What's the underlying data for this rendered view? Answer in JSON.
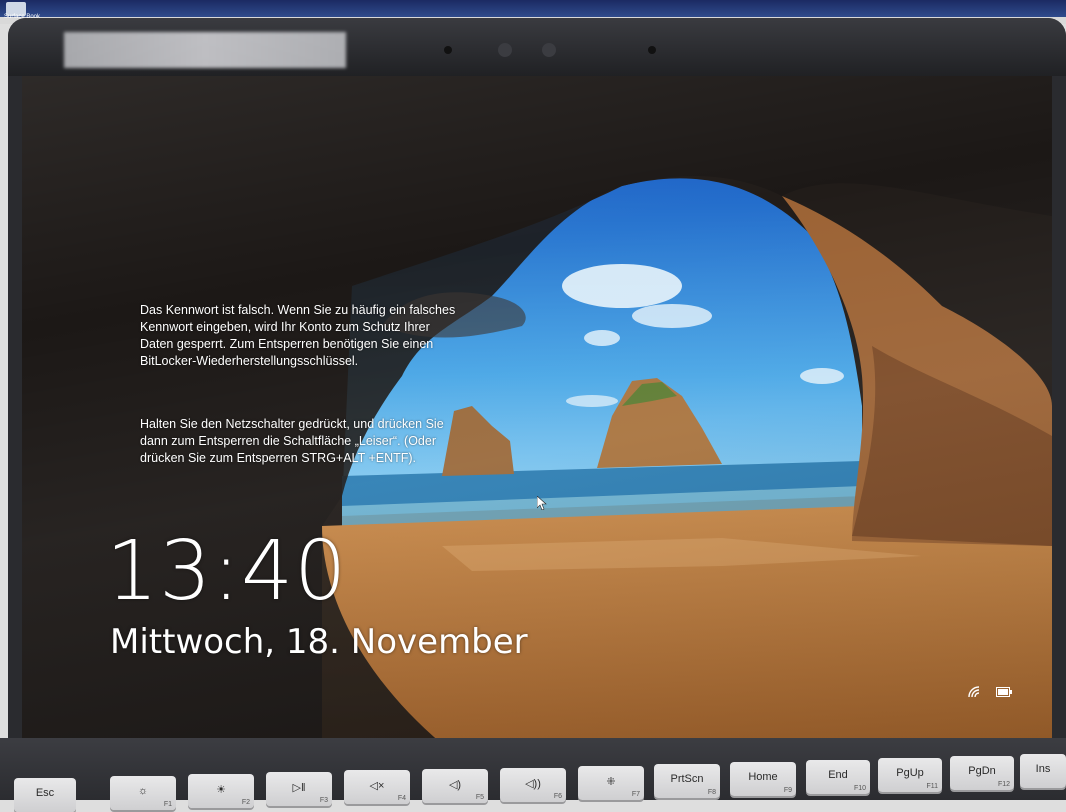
{
  "desktop": {
    "icon_label": "Surface Book"
  },
  "lock_screen": {
    "message_1": "Das Kennwort ist falsch. Wenn Sie zu häufig ein falsches Kennwort eingeben, wird Ihr Konto zum Schutz Ihrer Daten gesperrt. Zum Entsperren benötigen Sie einen BitLocker-Wiederherstellungsschlüssel.",
    "message_2": "Halten Sie den Netzschalter gedrückt, und drücken Sie dann zum Entsperren die Schaltfläche „Leiser“. (Oder drücken Sie zum Entsperren STRG+ALT +ENTF).",
    "time": "13:40",
    "date": "Mittwoch, 18. November",
    "status_icons": [
      "wifi-icon",
      "battery-icon"
    ]
  },
  "keyboard": {
    "keys": [
      {
        "label": "Esc",
        "fn": ""
      },
      {
        "label": "☼",
        "fn": "F1"
      },
      {
        "label": "☀",
        "fn": "F2"
      },
      {
        "label": "▷‖",
        "fn": "F3"
      },
      {
        "label": "◁×",
        "fn": "F4"
      },
      {
        "label": "◁)",
        "fn": "F5"
      },
      {
        "label": "◁))",
        "fn": "F6"
      },
      {
        "label": "⁜",
        "fn": "F7"
      },
      {
        "label": "PrtScn",
        "fn": "F8"
      },
      {
        "label": "Home",
        "fn": "F9"
      },
      {
        "label": "End",
        "fn": "F10"
      },
      {
        "label": "PgUp",
        "fn": "F11"
      },
      {
        "label": "PgDn",
        "fn": "F12"
      },
      {
        "label": "Ins",
        "fn": ""
      }
    ]
  }
}
